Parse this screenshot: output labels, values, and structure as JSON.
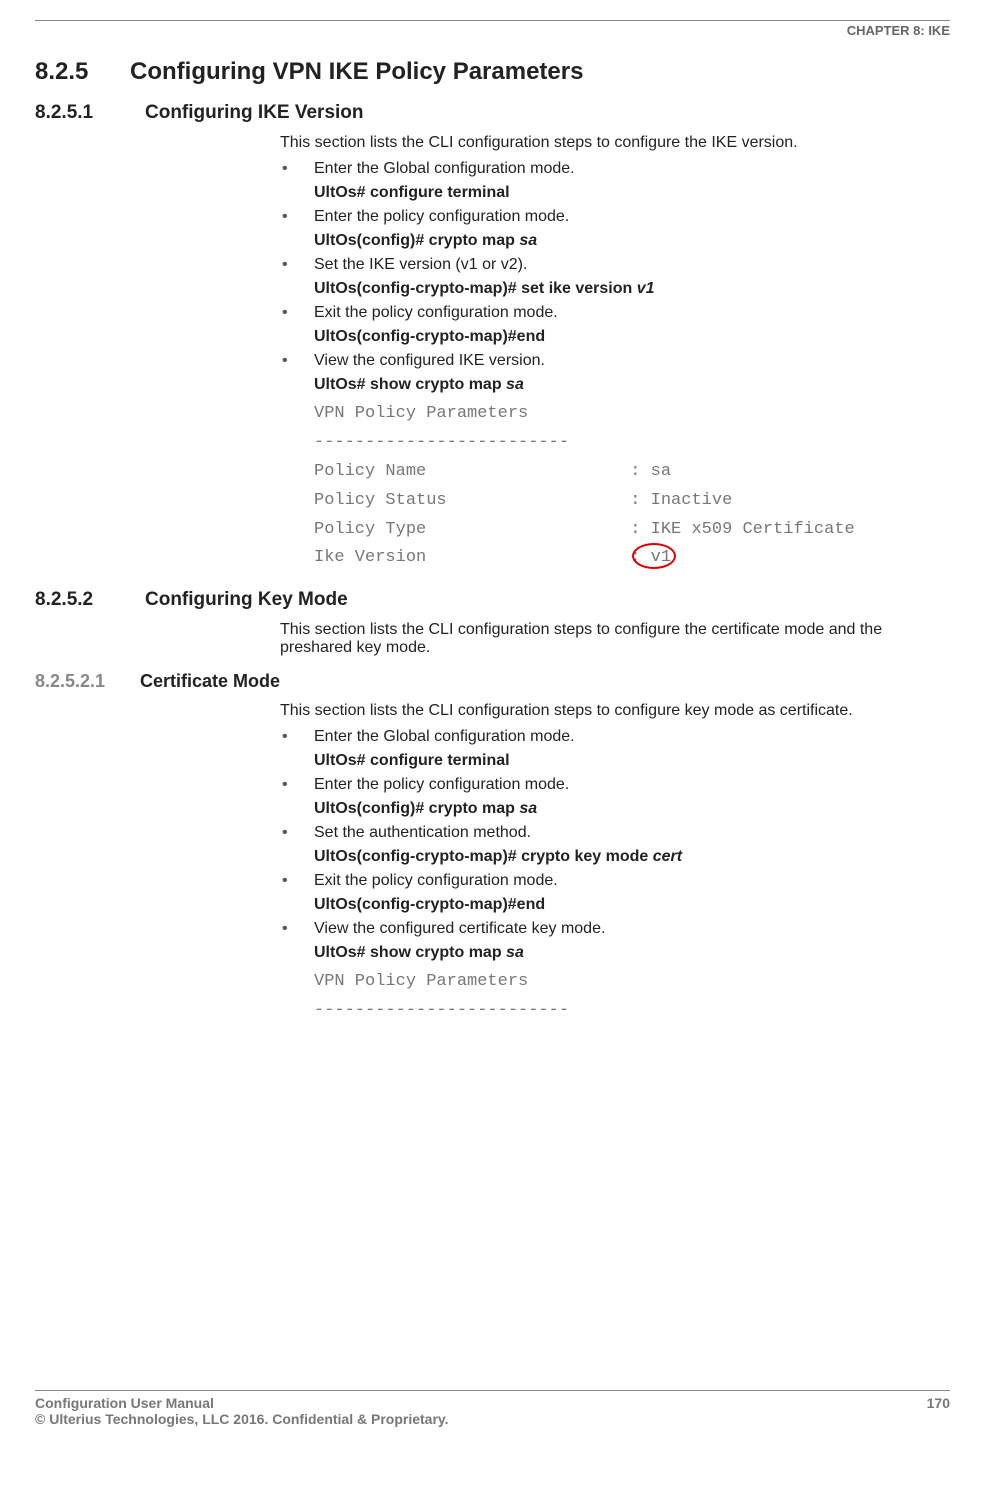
{
  "header": {
    "chapter": "CHAPTER 8: IKE"
  },
  "sec825": {
    "num": "8.2.5",
    "title": "Configuring VPN IKE Policy Parameters"
  },
  "sec8251": {
    "num": "8.2.5.1",
    "title": "Configuring IKE Version",
    "intro": "This section lists the CLI configuration steps to configure the IKE version.",
    "b1": "Enter the Global configuration mode.",
    "c1": "UltOs# configure terminal",
    "b2": "Enter the policy configuration mode.",
    "c2a": "UltOs(config)# crypto map ",
    "c2b": "sa",
    "b3": "Set the IKE version (v1 or v2).",
    "c3a": "UltOs(config-crypto-map)# set ike version ",
    "c3b": "v1",
    "b4": "Exit the policy configuration mode.",
    "c4": "UltOs(config-crypto-map)#end",
    "b5": "View the configured IKE version.",
    "c5a": "UltOs# show crypto map ",
    "c5b": "sa",
    "out": "VPN Policy Parameters\n-------------------------\nPolicy Name                    : sa\nPolicy Status                  : Inactive\nPolicy Type                    : IKE x509 Certificate\nIke Version                    : v1"
  },
  "sec8252": {
    "num": "8.2.5.2",
    "title": "Configuring Key Mode",
    "intro": "This section lists the CLI configuration steps to configure the certificate mode and the preshared key mode."
  },
  "sec82521": {
    "num": "8.2.5.2.1",
    "title": "Certificate Mode",
    "intro": "This section lists the CLI configuration steps to configure key mode as certificate.",
    "b1": "Enter the Global configuration mode.",
    "c1": "UltOs# configure terminal",
    "b2": "Enter the policy configuration mode.",
    "c2a": "UltOs(config)# crypto map ",
    "c2b": "sa",
    "b3": "Set the authentication method.",
    "c3a": "UltOs(config-crypto-map)# crypto key mode ",
    "c3b": "cert",
    "b4": "Exit the policy configuration mode.",
    "c4": "UltOs(config-crypto-map)#end",
    "b5": "View the configured certificate key mode.",
    "c5a": "UltOs# show crypto map ",
    "c5b": "sa",
    "out": "VPN Policy Parameters\n-------------------------"
  },
  "footer": {
    "left1": "Configuration User Manual",
    "left2": "© Ulterius Technologies, LLC 2016. Confidential & Proprietary.",
    "page": "170"
  }
}
